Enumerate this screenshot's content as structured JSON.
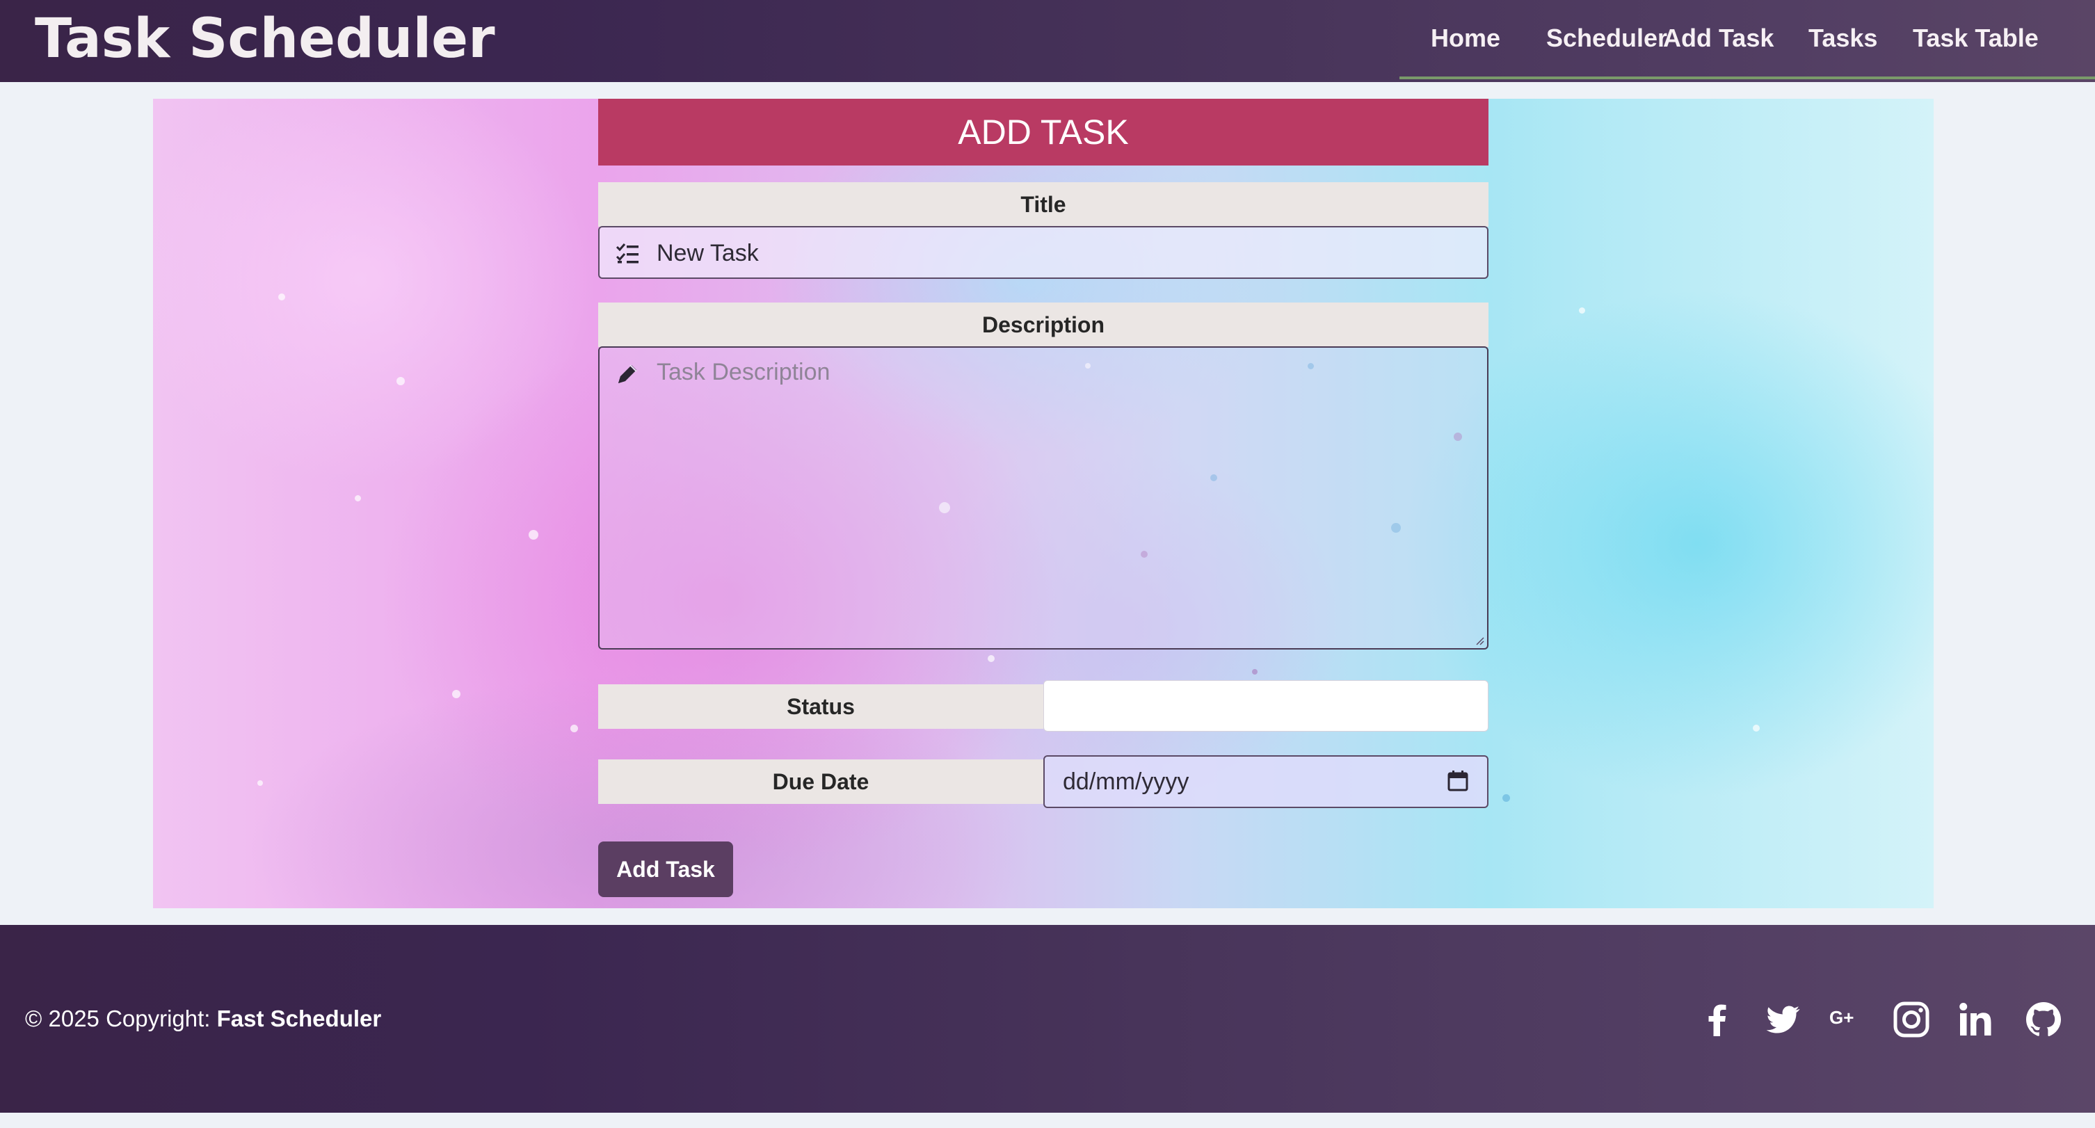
{
  "brand": {
    "title": "Task Scheduler"
  },
  "nav": {
    "items": [
      {
        "label": "Home"
      },
      {
        "label": "Scheduler"
      },
      {
        "label": "Add Task"
      },
      {
        "label": "Tasks"
      },
      {
        "label": "Task Table"
      }
    ],
    "accent_underline": "#7a9a6a"
  },
  "form": {
    "heading": "ADD TASK",
    "title_label": "Title",
    "title_value": "New Task",
    "title_icon": "list-check-icon",
    "description_label": "Description",
    "description_placeholder": "Task Description",
    "description_icon": "pencil-icon",
    "status_label": "Status",
    "status_value": "",
    "due_date_label": "Due Date",
    "due_date_value": "dd/mm/yyyy",
    "due_date_icon": "calendar-icon",
    "submit_label": "Add Task"
  },
  "footer": {
    "copyright_prefix": "© 2025 Copyright: ",
    "copyright_owner": "Fast Scheduler",
    "social": [
      {
        "icon": "facebook-icon"
      },
      {
        "icon": "twitter-icon"
      },
      {
        "icon": "google-plus-icon"
      },
      {
        "icon": "instagram-icon"
      },
      {
        "icon": "linkedin-icon"
      },
      {
        "icon": "github-icon"
      }
    ]
  },
  "colors": {
    "header_bg": "#3b2650",
    "heading_bg": "#b93a63",
    "label_bg": "#ebe6e4",
    "button_bg": "#5b3e62"
  }
}
